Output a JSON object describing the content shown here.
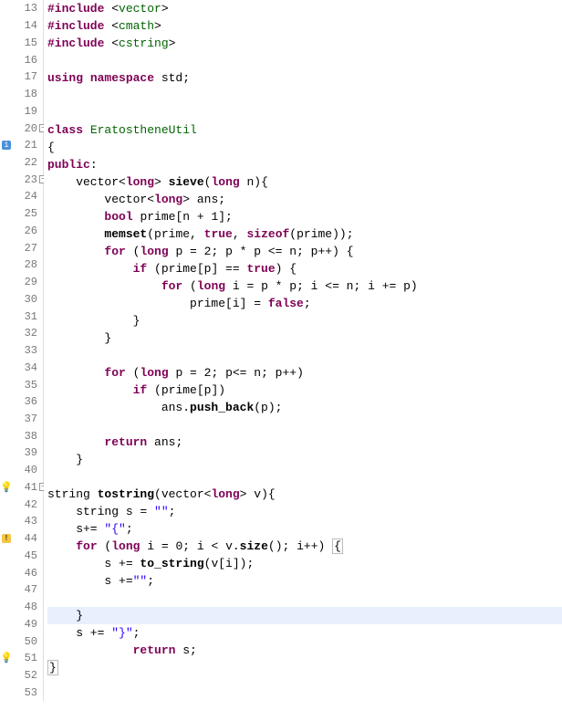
{
  "editor": {
    "first_line": 13,
    "current_line": 48,
    "lines": [
      {
        "n": 13,
        "tokens": [
          [
            "kw",
            "#include "
          ],
          [
            "pln",
            "<"
          ],
          [
            "sys",
            "vector"
          ],
          [
            "pln",
            ">"
          ]
        ]
      },
      {
        "n": 14,
        "tokens": [
          [
            "kw",
            "#include "
          ],
          [
            "pln",
            "<"
          ],
          [
            "sys",
            "cmath"
          ],
          [
            "pln",
            ">"
          ]
        ]
      },
      {
        "n": 15,
        "tokens": [
          [
            "kw",
            "#include "
          ],
          [
            "pln",
            "<"
          ],
          [
            "sys",
            "cstring"
          ],
          [
            "pln",
            ">"
          ]
        ]
      },
      {
        "n": 16,
        "tokens": []
      },
      {
        "n": 17,
        "tokens": [
          [
            "kw",
            "using "
          ],
          [
            "kw",
            "namespace "
          ],
          [
            "pln",
            "std;"
          ]
        ]
      },
      {
        "n": 18,
        "tokens": []
      },
      {
        "n": 19,
        "tokens": []
      },
      {
        "n": 20,
        "fold": true,
        "tokens": [
          [
            "kw",
            "class "
          ],
          [
            "cls",
            "EratostheneUtil"
          ]
        ]
      },
      {
        "n": 21,
        "marker": "info",
        "tokens": [
          [
            "pln",
            "{"
          ]
        ]
      },
      {
        "n": 22,
        "tokens": [
          [
            "kw",
            "public"
          ],
          [
            "pln",
            ":"
          ]
        ]
      },
      {
        "n": 23,
        "fold": true,
        "tokens": [
          [
            "pln",
            "    vector<"
          ],
          [
            "kw",
            "long"
          ],
          [
            "pln",
            "> "
          ],
          [
            "fn",
            "sieve"
          ],
          [
            "pln",
            "("
          ],
          [
            "kw",
            "long"
          ],
          [
            "pln",
            " n){"
          ]
        ]
      },
      {
        "n": 24,
        "tokens": [
          [
            "pln",
            "        vector<"
          ],
          [
            "kw",
            "long"
          ],
          [
            "pln",
            "> ans;"
          ]
        ]
      },
      {
        "n": 25,
        "tokens": [
          [
            "pln",
            "        "
          ],
          [
            "kw",
            "bool"
          ],
          [
            "pln",
            " prime[n + 1];"
          ]
        ]
      },
      {
        "n": 26,
        "tokens": [
          [
            "pln",
            "        "
          ],
          [
            "fn",
            "memset"
          ],
          [
            "pln",
            "(prime, "
          ],
          [
            "kw",
            "true"
          ],
          [
            "pln",
            ", "
          ],
          [
            "kw",
            "sizeof"
          ],
          [
            "pln",
            "(prime));"
          ]
        ]
      },
      {
        "n": 27,
        "tokens": [
          [
            "pln",
            "        "
          ],
          [
            "kw",
            "for"
          ],
          [
            "pln",
            " ("
          ],
          [
            "kw",
            "long"
          ],
          [
            "pln",
            " p = 2; p * p <= n; p++) {"
          ]
        ]
      },
      {
        "n": 28,
        "tokens": [
          [
            "pln",
            "            "
          ],
          [
            "kw",
            "if"
          ],
          [
            "pln",
            " (prime[p] == "
          ],
          [
            "kw",
            "true"
          ],
          [
            "pln",
            ") {"
          ]
        ]
      },
      {
        "n": 29,
        "tokens": [
          [
            "pln",
            "                "
          ],
          [
            "kw",
            "for"
          ],
          [
            "pln",
            " ("
          ],
          [
            "kw",
            "long"
          ],
          [
            "pln",
            " i = p * p; i <= n; i += p)"
          ]
        ]
      },
      {
        "n": 30,
        "tokens": [
          [
            "pln",
            "                    prime[i] = "
          ],
          [
            "kw",
            "false"
          ],
          [
            "pln",
            ";"
          ]
        ]
      },
      {
        "n": 31,
        "tokens": [
          [
            "pln",
            "            }"
          ]
        ]
      },
      {
        "n": 32,
        "tokens": [
          [
            "pln",
            "        }"
          ]
        ]
      },
      {
        "n": 33,
        "tokens": []
      },
      {
        "n": 34,
        "tokens": [
          [
            "pln",
            "        "
          ],
          [
            "kw",
            "for"
          ],
          [
            "pln",
            " ("
          ],
          [
            "kw",
            "long"
          ],
          [
            "pln",
            " p = 2; p<= n; p++)"
          ]
        ]
      },
      {
        "n": 35,
        "tokens": [
          [
            "pln",
            "            "
          ],
          [
            "kw",
            "if"
          ],
          [
            "pln",
            " (prime[p])"
          ]
        ]
      },
      {
        "n": 36,
        "tokens": [
          [
            "pln",
            "                ans."
          ],
          [
            "fn",
            "push_back"
          ],
          [
            "pln",
            "(p);"
          ]
        ]
      },
      {
        "n": 37,
        "tokens": []
      },
      {
        "n": 38,
        "tokens": [
          [
            "pln",
            "        "
          ],
          [
            "kw",
            "return"
          ],
          [
            "pln",
            " ans;"
          ]
        ]
      },
      {
        "n": 39,
        "tokens": [
          [
            "pln",
            "    }"
          ]
        ]
      },
      {
        "n": 40,
        "tokens": []
      },
      {
        "n": 41,
        "fold": true,
        "marker": "lightbulb",
        "tokens": [
          [
            "pln",
            "string "
          ],
          [
            "fn",
            "tostring"
          ],
          [
            "pln",
            "(vector<"
          ],
          [
            "kw",
            "long"
          ],
          [
            "pln",
            "> v){"
          ]
        ]
      },
      {
        "n": 42,
        "tokens": [
          [
            "pln",
            "    string s = "
          ],
          [
            "str",
            "\"\""
          ],
          [
            "pln",
            ";"
          ]
        ]
      },
      {
        "n": 43,
        "tokens": [
          [
            "pln",
            "    s+= "
          ],
          [
            "str",
            "\"{\""
          ],
          [
            "pln",
            ";"
          ]
        ]
      },
      {
        "n": 44,
        "marker": "warn",
        "tokens": [
          [
            "pln",
            "    "
          ],
          [
            "kw",
            "for"
          ],
          [
            "pln",
            " ("
          ],
          [
            "kw",
            "long"
          ],
          [
            "pln",
            " i = 0; i < v."
          ],
          [
            "fn",
            "size"
          ],
          [
            "pln",
            "(); i++) "
          ],
          [
            "box",
            "{"
          ]
        ]
      },
      {
        "n": 45,
        "tokens": [
          [
            "pln",
            "        s += "
          ],
          [
            "fn",
            "to_string"
          ],
          [
            "pln",
            "(v[i]);"
          ]
        ]
      },
      {
        "n": 46,
        "tokens": [
          [
            "pln",
            "        s +="
          ],
          [
            "str",
            "\"\""
          ],
          [
            "pln",
            ";"
          ]
        ]
      },
      {
        "n": 47,
        "tokens": []
      },
      {
        "n": 48,
        "current": true,
        "tokens": [
          [
            "pln",
            "    }"
          ]
        ]
      },
      {
        "n": 49,
        "tokens": [
          [
            "pln",
            "    s += "
          ],
          [
            "str",
            "\"}\""
          ],
          [
            "pln",
            ";"
          ]
        ]
      },
      {
        "n": 50,
        "tokens": [
          [
            "pln",
            "            "
          ],
          [
            "kw",
            "return"
          ],
          [
            "pln",
            " s;"
          ]
        ]
      },
      {
        "n": 51,
        "marker": "lightbulb",
        "tokens": [
          [
            "box",
            "}"
          ]
        ]
      },
      {
        "n": 52,
        "tokens": []
      },
      {
        "n": 53,
        "tokens": []
      }
    ]
  }
}
